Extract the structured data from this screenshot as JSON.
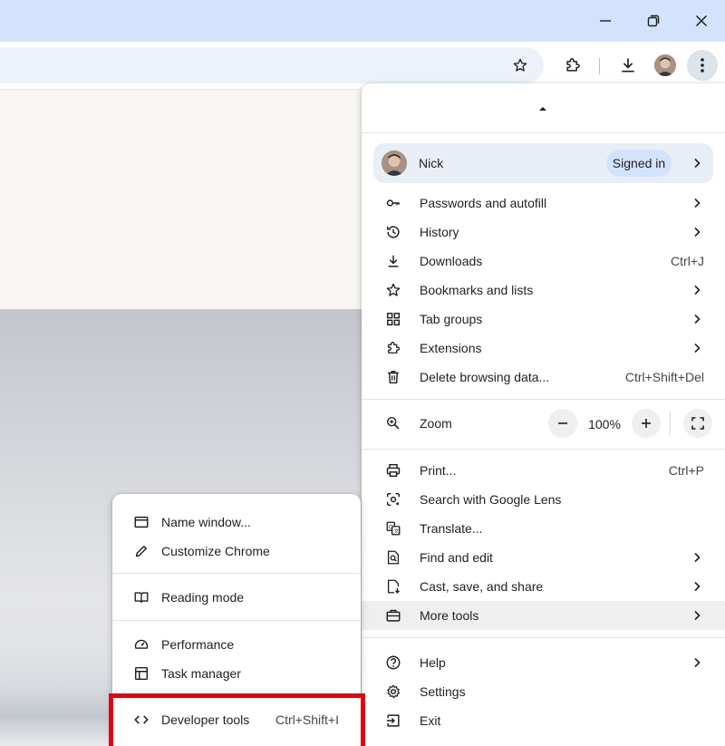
{
  "window": {
    "minimize_icon": "minimize-icon",
    "restore_icon": "restore-icon",
    "close_icon": "close-icon"
  },
  "toolbar": {
    "star_icon": "star-icon",
    "extensions_icon": "puzzle-icon",
    "downloads_icon": "download-icon",
    "menu_icon": "kebab-menu-icon"
  },
  "menu": {
    "profile": {
      "name": "Nick",
      "status": "Signed in"
    },
    "items_group1": [
      {
        "label": "Passwords and autofill",
        "icon": "key-icon",
        "shortcut": "",
        "submenu": true
      },
      {
        "label": "History",
        "icon": "history-icon",
        "shortcut": "",
        "submenu": true
      },
      {
        "label": "Downloads",
        "icon": "download-icon",
        "shortcut": "Ctrl+J",
        "submenu": false
      },
      {
        "label": "Bookmarks and lists",
        "icon": "star-icon",
        "shortcut": "",
        "submenu": true
      },
      {
        "label": "Tab groups",
        "icon": "tab-groups-icon",
        "shortcut": "",
        "submenu": true
      },
      {
        "label": "Extensions",
        "icon": "puzzle-icon",
        "shortcut": "",
        "submenu": true
      },
      {
        "label": "Delete browsing data...",
        "icon": "trash-icon",
        "shortcut": "Ctrl+Shift+Del",
        "submenu": false
      }
    ],
    "zoom": {
      "label": "Zoom",
      "value": "100%",
      "minus": "−",
      "plus": "+"
    },
    "items_group2": [
      {
        "label": "Print...",
        "icon": "printer-icon",
        "shortcut": "Ctrl+P",
        "submenu": false
      },
      {
        "label": "Search with Google Lens",
        "icon": "lens-icon",
        "shortcut": "",
        "submenu": false
      },
      {
        "label": "Translate...",
        "icon": "translate-icon",
        "shortcut": "",
        "submenu": false
      },
      {
        "label": "Find and edit",
        "icon": "find-icon",
        "shortcut": "",
        "submenu": true
      },
      {
        "label": "Cast, save, and share",
        "icon": "cast-save-icon",
        "shortcut": "",
        "submenu": true
      },
      {
        "label": "More tools",
        "icon": "toolbox-icon",
        "shortcut": "",
        "submenu": true,
        "highlighted": true
      }
    ],
    "items_group3": [
      {
        "label": "Help",
        "icon": "help-icon",
        "shortcut": "",
        "submenu": true
      },
      {
        "label": "Settings",
        "icon": "gear-icon",
        "shortcut": "",
        "submenu": false
      },
      {
        "label": "Exit",
        "icon": "exit-icon",
        "shortcut": "",
        "submenu": false
      }
    ]
  },
  "more_tools": {
    "items": [
      {
        "label": "Name window...",
        "icon": "window-icon",
        "shortcut": ""
      },
      {
        "label": "Customize Chrome",
        "icon": "pencil-icon",
        "shortcut": ""
      },
      {
        "label": "Reading mode",
        "icon": "book-icon",
        "shortcut": ""
      },
      {
        "label": "Performance",
        "icon": "gauge-icon",
        "shortcut": ""
      },
      {
        "label": "Task manager",
        "icon": "task-manager-icon",
        "shortcut": ""
      },
      {
        "label": "Developer tools",
        "icon": "code-icon",
        "shortcut": "Ctrl+Shift+I"
      }
    ]
  },
  "colors": {
    "titlebar": "#d3e3fd",
    "omnibox": "#edf2fa",
    "highlight_border": "#e3000f",
    "signed_in_pill": "#d3e3fd",
    "hover_row": "#efefef"
  }
}
